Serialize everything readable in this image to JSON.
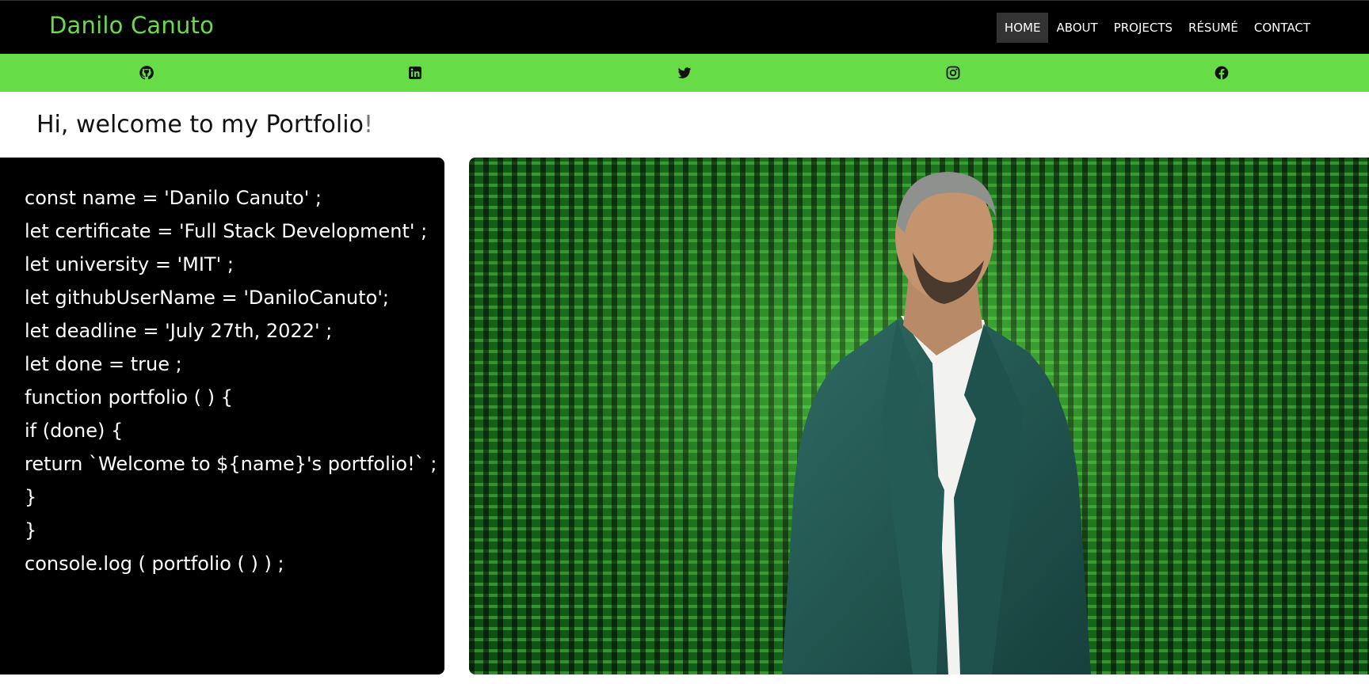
{
  "brand": "Danilo Canuto",
  "nav": {
    "items": [
      "HOME",
      "ABOUT",
      "PROJECTS",
      "RÉSUMÉ",
      "CONTACT"
    ],
    "active": "HOME"
  },
  "social": {
    "icons": [
      "github-icon",
      "linkedin-icon",
      "twitter-icon",
      "instagram-icon",
      "facebook-icon"
    ]
  },
  "greeting": {
    "text": "Hi, welcome to my Portfolio",
    "punctuation": "!"
  },
  "code_lines": [
    "const name = 'Danilo Canuto' ;",
    "let certificate = 'Full Stack Development' ;",
    "let university = 'MIT' ;",
    "let githubUserName = 'DaniloCanuto';",
    "let deadline = 'July 27th, 2022' ;",
    "let done = true ;",
    "function portfolio ( ) {",
    "if (done) {",
    "return `Welcome to ${name}'s portfolio!` ;",
    "}",
    "}",
    "console.log ( portfolio ( ) ) ;"
  ],
  "colors": {
    "accent": "#66dc46",
    "nav_bg": "#000000",
    "nav_active_bg": "#333333",
    "code_bg": "#000000"
  },
  "photo": {
    "subject": "man-in-suit-matrix-background"
  }
}
